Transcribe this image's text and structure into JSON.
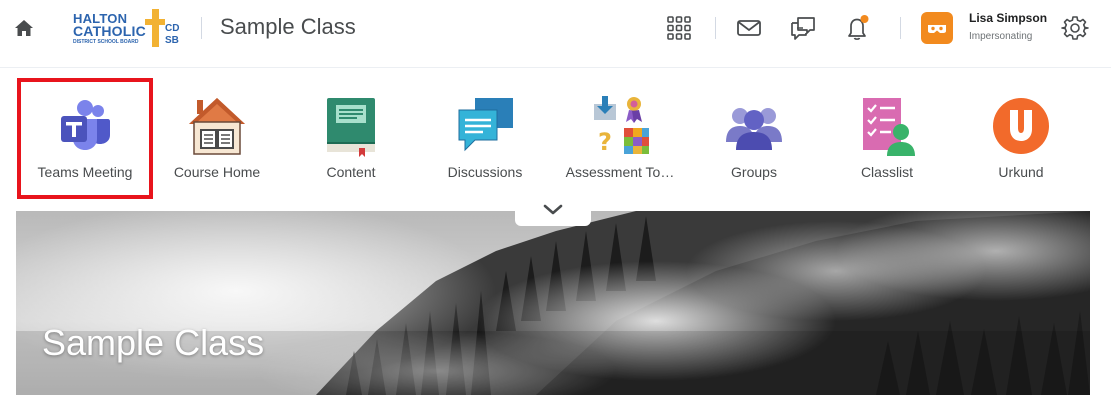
{
  "header": {
    "logo": {
      "line1": "HALTON",
      "line2": "CATHOLIC",
      "line3": "DISTRICT SCHOOL BOARD",
      "cd": "CD",
      "sb": "SB"
    },
    "course_title": "Sample Class",
    "icons": [
      "waffle-grid-icon",
      "mail-icon",
      "chat-icon",
      "bell-icon",
      "gear-icon"
    ],
    "user": {
      "name": "Lisa Simpson",
      "status": "Impersonating"
    }
  },
  "nav": {
    "items": [
      {
        "label": "Teams Meeting",
        "icon": "teams-icon",
        "highlighted": true
      },
      {
        "label": "Course Home",
        "icon": "house-icon"
      },
      {
        "label": "Content",
        "icon": "book-icon"
      },
      {
        "label": "Discussions",
        "icon": "speech-bubbles-icon"
      },
      {
        "label": "Assessment To…",
        "icon": "assessment-tools-icon"
      },
      {
        "label": "Groups",
        "icon": "people-icon"
      },
      {
        "label": "Classlist",
        "icon": "classlist-icon"
      },
      {
        "label": "Urkund",
        "icon": "urkund-icon"
      }
    ]
  },
  "banner": {
    "title": "Sample Class"
  },
  "colors": {
    "highlight": "#e8141c",
    "avatar": "#f28a1e",
    "notification_dot": "#f28a1e",
    "brand_blue": "#2c64ae",
    "brand_gold": "#f2b233"
  }
}
